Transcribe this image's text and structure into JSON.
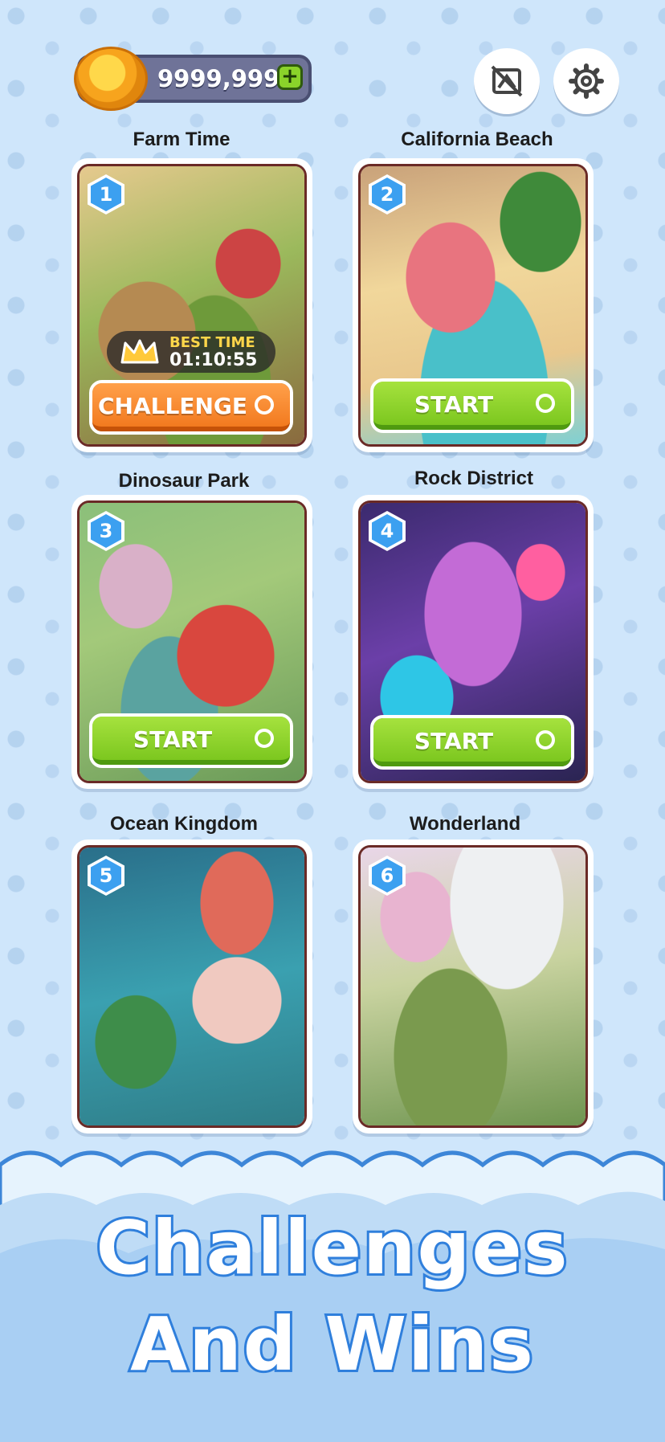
{
  "header": {
    "coins": "9999,999",
    "plus_label": "+",
    "no_ads_icon": "no-ads-icon",
    "settings_icon": "gear-icon"
  },
  "levels": [
    {
      "number": "1",
      "title": "Farm Time",
      "button": "CHALLENGE",
      "best_time_label": "BEST TIME",
      "best_time": "01:10:55"
    },
    {
      "number": "2",
      "title": "California Beach",
      "button": "START"
    },
    {
      "number": "3",
      "title": "Dinosaur Park",
      "button": "START"
    },
    {
      "number": "4",
      "title": "Rock District",
      "button": "START"
    },
    {
      "number": "5",
      "title": "Ocean Kingdom"
    },
    {
      "number": "6",
      "title": "Wonderland"
    }
  ],
  "banner": {
    "line1": "Challenges",
    "line2": "And Wins"
  },
  "colors": {
    "background": "#cfe6fb",
    "start_green": "#8ad32a",
    "challenge_orange": "#f27a1f",
    "badge_blue": "#3ca0f0",
    "headline_stroke": "#2f7fdc"
  }
}
